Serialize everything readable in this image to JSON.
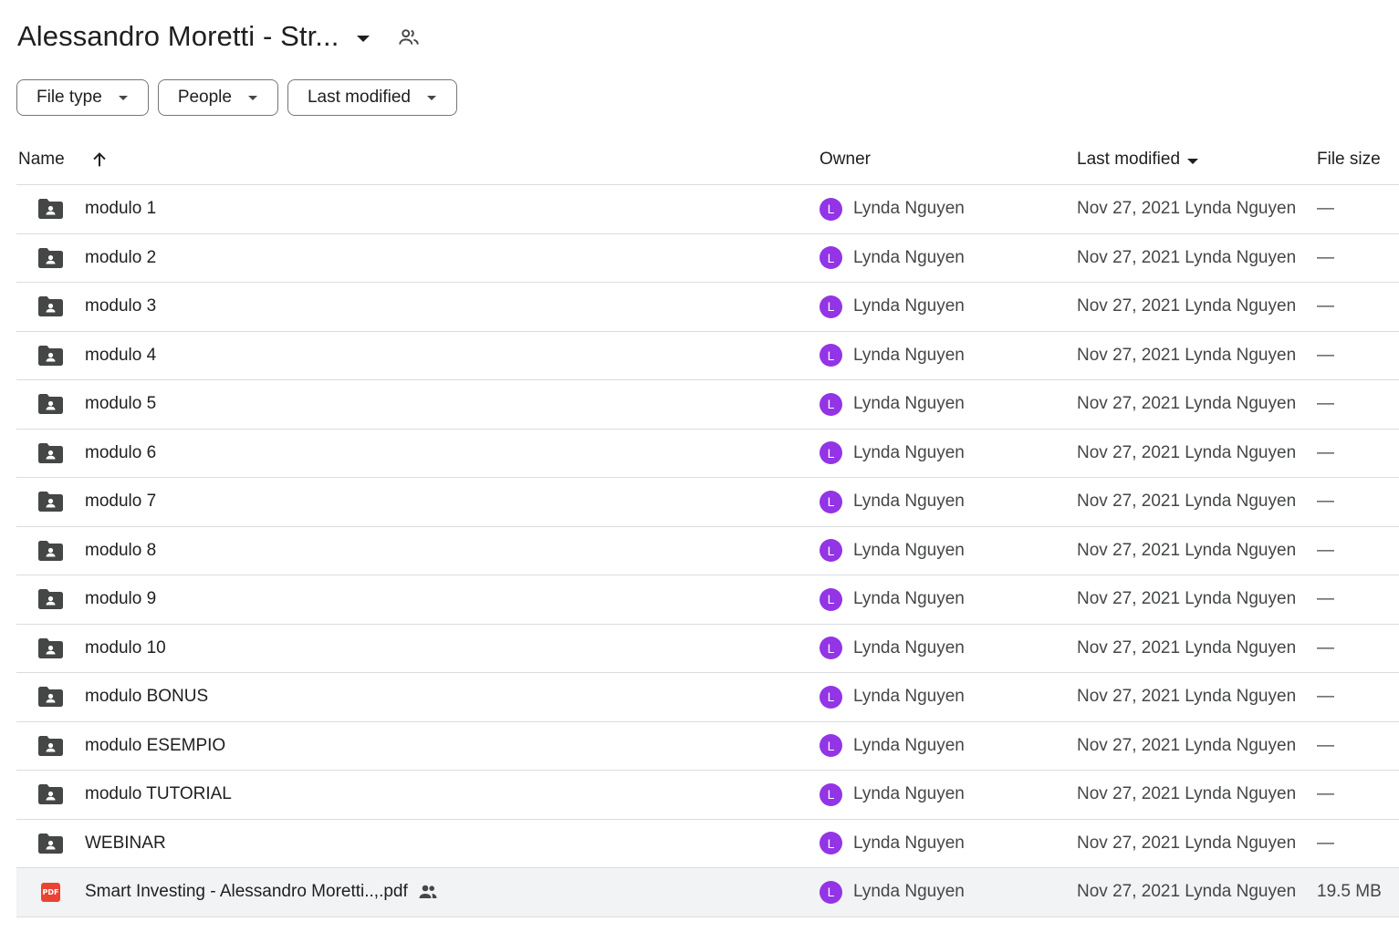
{
  "header": {
    "title": "Alessandro Moretti - Str...",
    "title_icon": "chevron-down-icon",
    "shared_icon": "people-icon"
  },
  "filters": [
    {
      "label": "File type"
    },
    {
      "label": "People"
    },
    {
      "label": "Last modified"
    }
  ],
  "columns": {
    "name": "Name",
    "owner": "Owner",
    "last_modified": "Last modified",
    "file_size": "File size"
  },
  "rows": [
    {
      "icon": "shared-folder-icon",
      "name": "modulo 1",
      "owner_initial": "L",
      "owner": "Lynda Nguyen",
      "modified": "Nov 27, 2021 Lynda Nguyen",
      "size": "—"
    },
    {
      "icon": "shared-folder-icon",
      "name": "modulo 2",
      "owner_initial": "L",
      "owner": "Lynda Nguyen",
      "modified": "Nov 27, 2021 Lynda Nguyen",
      "size": "—"
    },
    {
      "icon": "shared-folder-icon",
      "name": "modulo 3",
      "owner_initial": "L",
      "owner": "Lynda Nguyen",
      "modified": "Nov 27, 2021 Lynda Nguyen",
      "size": "—"
    },
    {
      "icon": "shared-folder-icon",
      "name": "modulo 4",
      "owner_initial": "L",
      "owner": "Lynda Nguyen",
      "modified": "Nov 27, 2021 Lynda Nguyen",
      "size": "—"
    },
    {
      "icon": "shared-folder-icon",
      "name": "modulo 5",
      "owner_initial": "L",
      "owner": "Lynda Nguyen",
      "modified": "Nov 27, 2021 Lynda Nguyen",
      "size": "—"
    },
    {
      "icon": "shared-folder-icon",
      "name": "modulo 6",
      "owner_initial": "L",
      "owner": "Lynda Nguyen",
      "modified": "Nov 27, 2021 Lynda Nguyen",
      "size": "—"
    },
    {
      "icon": "shared-folder-icon",
      "name": "modulo 7",
      "owner_initial": "L",
      "owner": "Lynda Nguyen",
      "modified": "Nov 27, 2021 Lynda Nguyen",
      "size": "—"
    },
    {
      "icon": "shared-folder-icon",
      "name": "modulo 8",
      "owner_initial": "L",
      "owner": "Lynda Nguyen",
      "modified": "Nov 27, 2021 Lynda Nguyen",
      "size": "—"
    },
    {
      "icon": "shared-folder-icon",
      "name": "modulo 9",
      "owner_initial": "L",
      "owner": "Lynda Nguyen",
      "modified": "Nov 27, 2021 Lynda Nguyen",
      "size": "—"
    },
    {
      "icon": "shared-folder-icon",
      "name": "modulo 10",
      "owner_initial": "L",
      "owner": "Lynda Nguyen",
      "modified": "Nov 27, 2021 Lynda Nguyen",
      "size": "—"
    },
    {
      "icon": "shared-folder-icon",
      "name": "modulo BONUS",
      "owner_initial": "L",
      "owner": "Lynda Nguyen",
      "modified": "Nov 27, 2021 Lynda Nguyen",
      "size": "—"
    },
    {
      "icon": "shared-folder-icon",
      "name": "modulo ESEMPIO",
      "owner_initial": "L",
      "owner": "Lynda Nguyen",
      "modified": "Nov 27, 2021 Lynda Nguyen",
      "size": "—"
    },
    {
      "icon": "shared-folder-icon",
      "name": "modulo TUTORIAL",
      "owner_initial": "L",
      "owner": "Lynda Nguyen",
      "modified": "Nov 27, 2021 Lynda Nguyen",
      "size": "—"
    },
    {
      "icon": "shared-folder-icon",
      "name": "WEBINAR",
      "owner_initial": "L",
      "owner": "Lynda Nguyen",
      "modified": "Nov 27, 2021 Lynda Nguyen",
      "size": "—"
    },
    {
      "icon": "pdf-icon",
      "icon_text": "PDF",
      "name": "Smart Investing - Alessandro Moretti..,.pdf",
      "shared": true,
      "owner_initial": "L",
      "owner": "Lynda Nguyen",
      "modified": "Nov 27, 2021 Lynda Nguyen",
      "size": "19.5 MB",
      "selected": true
    }
  ],
  "colors": {
    "avatar": "#9334e6",
    "pdf": "#ea4335",
    "selected_row": "#f1f3f4"
  }
}
